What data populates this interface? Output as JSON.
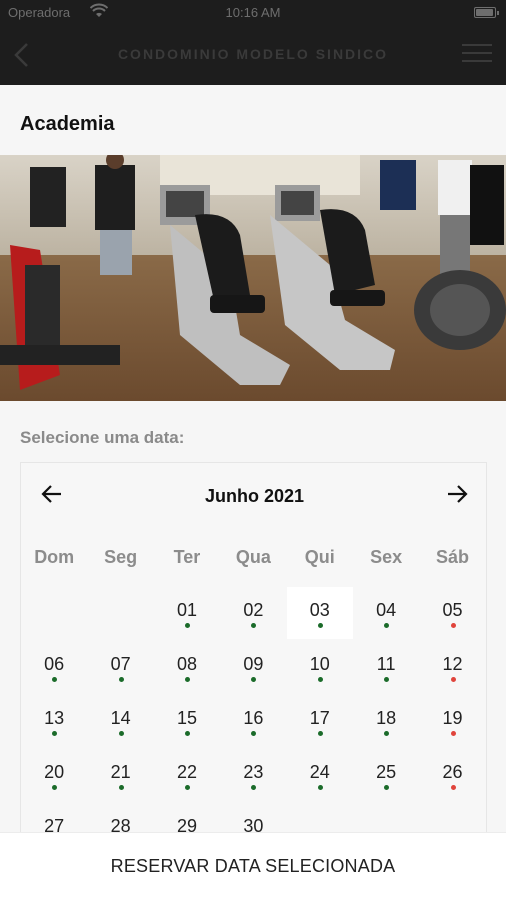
{
  "statusbar": {
    "carrier": "Operadora",
    "time": "10:16 AM"
  },
  "navbar": {
    "title": "CONDOMINIO MODELO SINDICO"
  },
  "section": {
    "title": "Academia"
  },
  "calendar": {
    "label": "Selecione uma data:",
    "month": "Junho 2021",
    "weekdays": [
      "Dom",
      "Seg",
      "Ter",
      "Qua",
      "Qui",
      "Sex",
      "Sáb"
    ],
    "selected": "03",
    "weeks": [
      [
        null,
        null,
        {
          "d": "01",
          "s": "green"
        },
        {
          "d": "02",
          "s": "green"
        },
        {
          "d": "03",
          "s": "green"
        },
        {
          "d": "04",
          "s": "green"
        },
        {
          "d": "05",
          "s": "red"
        }
      ],
      [
        {
          "d": "06",
          "s": "green"
        },
        {
          "d": "07",
          "s": "green"
        },
        {
          "d": "08",
          "s": "green"
        },
        {
          "d": "09",
          "s": "green"
        },
        {
          "d": "10",
          "s": "green"
        },
        {
          "d": "11",
          "s": "green"
        },
        {
          "d": "12",
          "s": "red"
        }
      ],
      [
        {
          "d": "13",
          "s": "green"
        },
        {
          "d": "14",
          "s": "green"
        },
        {
          "d": "15",
          "s": "green"
        },
        {
          "d": "16",
          "s": "green"
        },
        {
          "d": "17",
          "s": "green"
        },
        {
          "d": "18",
          "s": "green"
        },
        {
          "d": "19",
          "s": "red"
        }
      ],
      [
        {
          "d": "20",
          "s": "green"
        },
        {
          "d": "21",
          "s": "green"
        },
        {
          "d": "22",
          "s": "green"
        },
        {
          "d": "23",
          "s": "green"
        },
        {
          "d": "24",
          "s": "green"
        },
        {
          "d": "25",
          "s": "green"
        },
        {
          "d": "26",
          "s": "red"
        }
      ],
      [
        {
          "d": "27",
          "s": "none"
        },
        {
          "d": "28",
          "s": "none"
        },
        {
          "d": "29",
          "s": "none"
        },
        {
          "d": "30",
          "s": "none"
        },
        null,
        null,
        null
      ]
    ]
  },
  "footer": {
    "reserve_label": "RESERVAR DATA SELECIONADA"
  },
  "colors": {
    "available": "#1b6b2a",
    "unavailable": "#e0443c",
    "navbar": "#1d1d1d"
  }
}
